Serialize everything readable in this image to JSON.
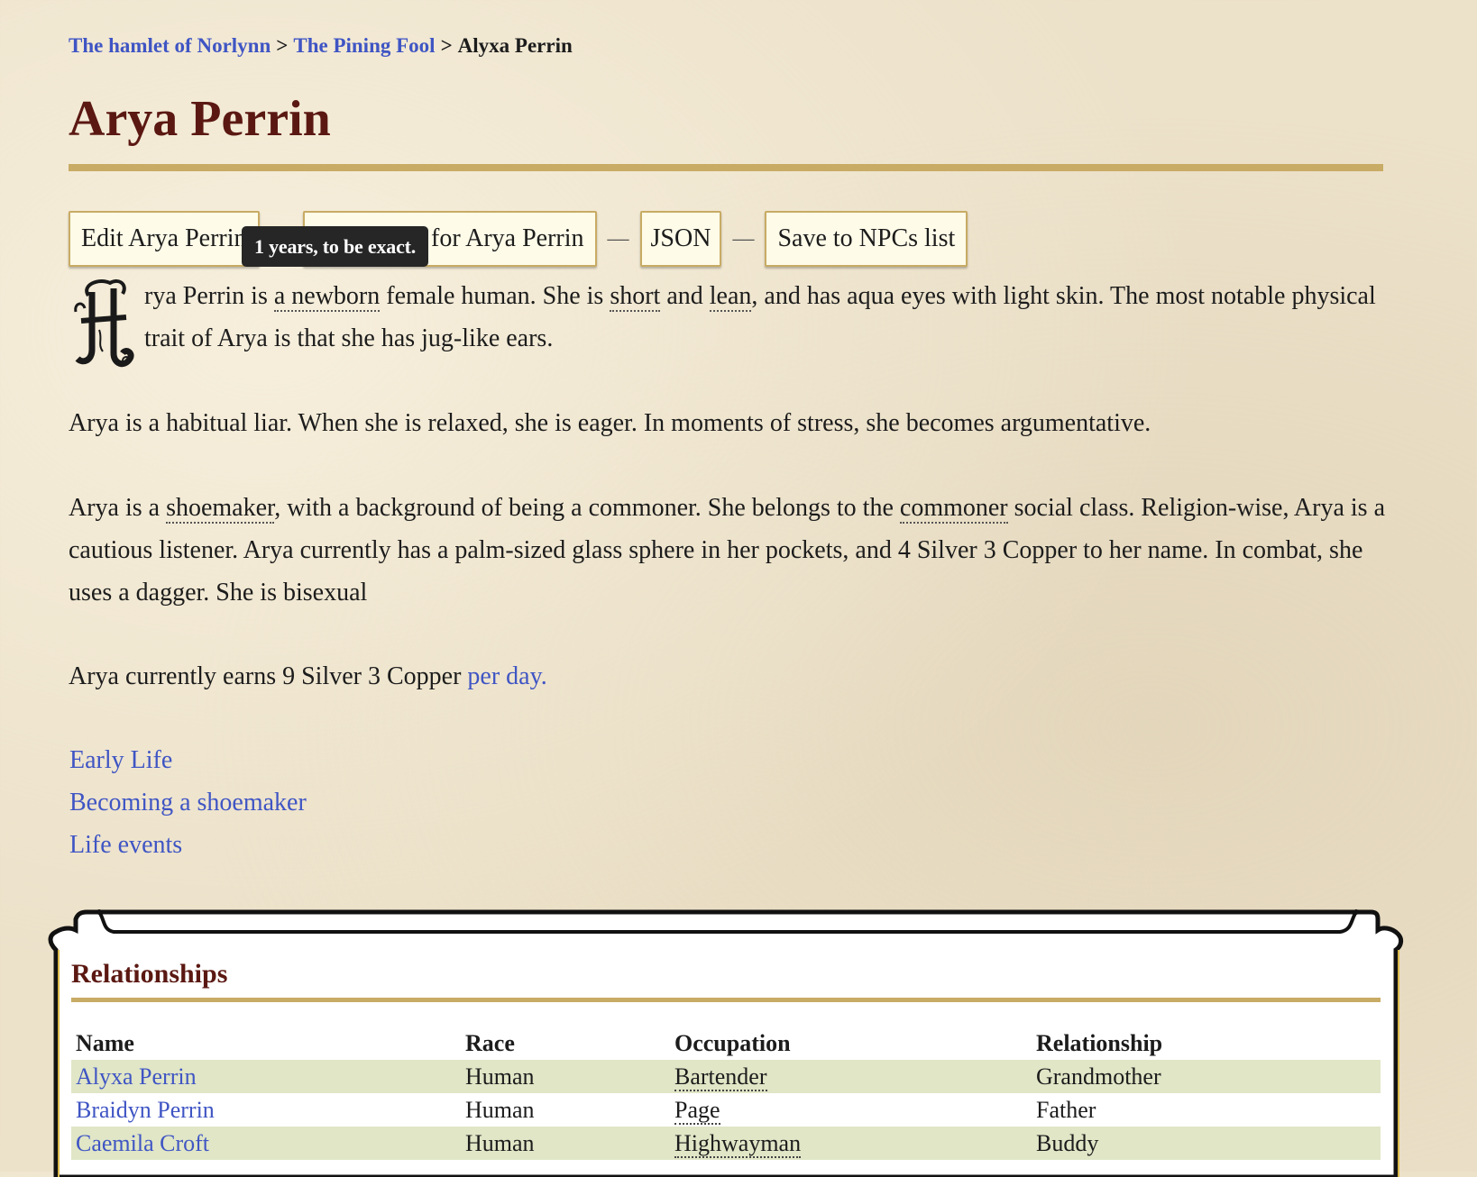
{
  "breadcrumb": {
    "items": [
      "The hamlet of Norlynn",
      "The Pining Fool"
    ],
    "separator": ">",
    "current": "Alyxa Perrin"
  },
  "page_title": "Arya Perrin",
  "buttons": {
    "edit": "Edit Arya Perrin",
    "second_visible_part": "for Arya Perrin",
    "json": "JSON",
    "save": "Save to NPCs list",
    "separator": "—"
  },
  "tooltip": "1 years, to be exact.",
  "dropcap_letter": "A",
  "para1": {
    "t1": "rya Perrin is ",
    "age": "a newborn",
    "t2": " female human. She is ",
    "height": "short",
    "t3": " and ",
    "build": "lean",
    "t4": ", and has aqua eyes with light skin. The most notable physical trait of Arya is that she has jug-like ears."
  },
  "para2": "Arya is a habitual liar. When she is relaxed, she is eager. In moments of stress, she becomes argumentative.",
  "para3": {
    "t1": "Arya is a ",
    "profession": "shoemaker",
    "t2": ", with a background of being a commoner. She belongs to the ",
    "social_class": "commoner",
    "t3": " social class. Religion-wise, Arya is a cautious listener. Arya currently has a palm-sized glass sphere in her pockets, and 4 Silver 3 Copper to her name. In combat, she uses a dagger. She is bisexual"
  },
  "para4": {
    "text": "Arya currently earns 9 Silver 3 Copper ",
    "link": "per day."
  },
  "toc": [
    "Early Life",
    "Becoming a shoemaker",
    "Life events"
  ],
  "relationships": {
    "title": "Relationships",
    "columns": [
      "Name",
      "Race",
      "Occupation",
      "Relationship"
    ],
    "rows": [
      {
        "name": "Alyxa Perrin",
        "race": "Human",
        "occupation": "Bartender",
        "relationship": "Grandmother"
      },
      {
        "name": "Braidyn Perrin",
        "race": "Human",
        "occupation": "Page",
        "relationship": "Father"
      },
      {
        "name": "Caemila Croft",
        "race": "Human",
        "occupation": "Highwayman",
        "relationship": "Buddy"
      }
    ]
  },
  "colors": {
    "title": "#5b1812",
    "link": "#3f55c4",
    "rule": "#c8ab64",
    "row_shade": "#e0e6c6",
    "tooltip_bg": "#262626"
  }
}
